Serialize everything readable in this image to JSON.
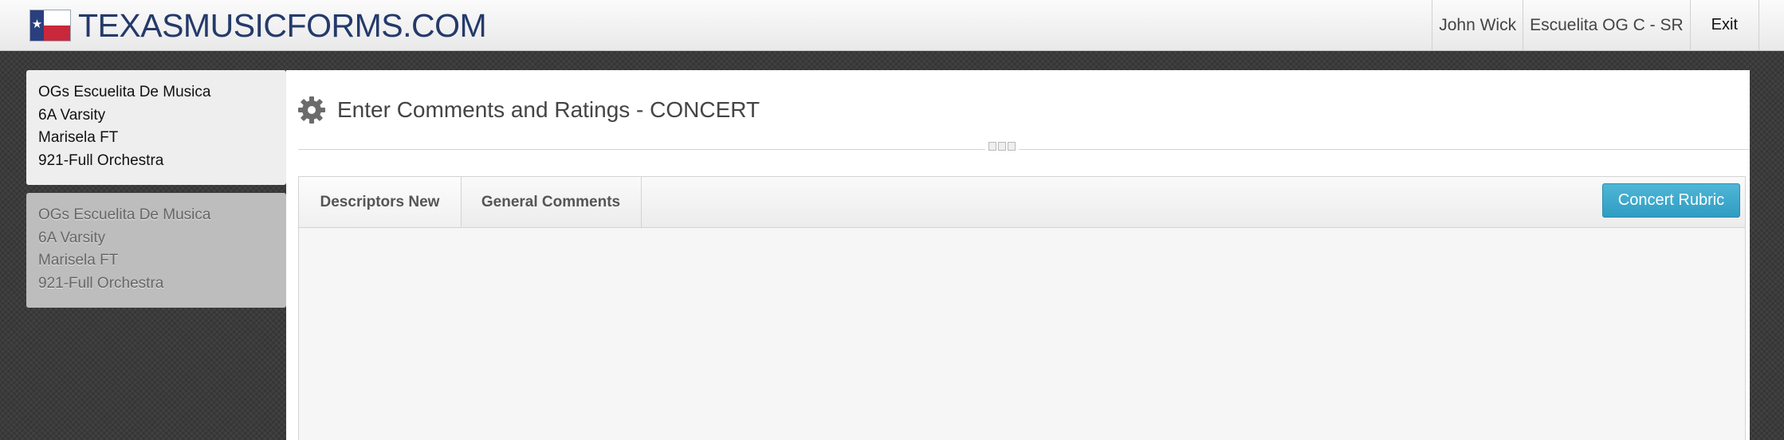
{
  "header": {
    "logo_text": "TEXASMUSICFORMS.COM",
    "nav": {
      "user_name": "John Wick",
      "school_name": "Escuelita OG C - SR",
      "exit_label": "Exit"
    }
  },
  "sidebar": {
    "cards": [
      {
        "state": "active",
        "lines": [
          "OGs Escuelita De Musica",
          "6A Varsity",
          "Marisela FT",
          "921-Full Orchestra"
        ]
      },
      {
        "state": "inactive",
        "lines": [
          "OGs Escuelita De Musica",
          "6A Varsity",
          "Marisela FT",
          "921-Full Orchestra"
        ]
      }
    ]
  },
  "main": {
    "title": "Enter Comments and Ratings - CONCERT",
    "title_icon": "gear-icon",
    "tabs": [
      {
        "label": "Descriptors New",
        "active": true
      },
      {
        "label": "General Comments",
        "active": false
      }
    ],
    "rubric_button_label": "Concert Rubric"
  },
  "colors": {
    "logo": "#243a6b",
    "accent_button": "#3aa8cc",
    "background": "#3b3b3b"
  }
}
